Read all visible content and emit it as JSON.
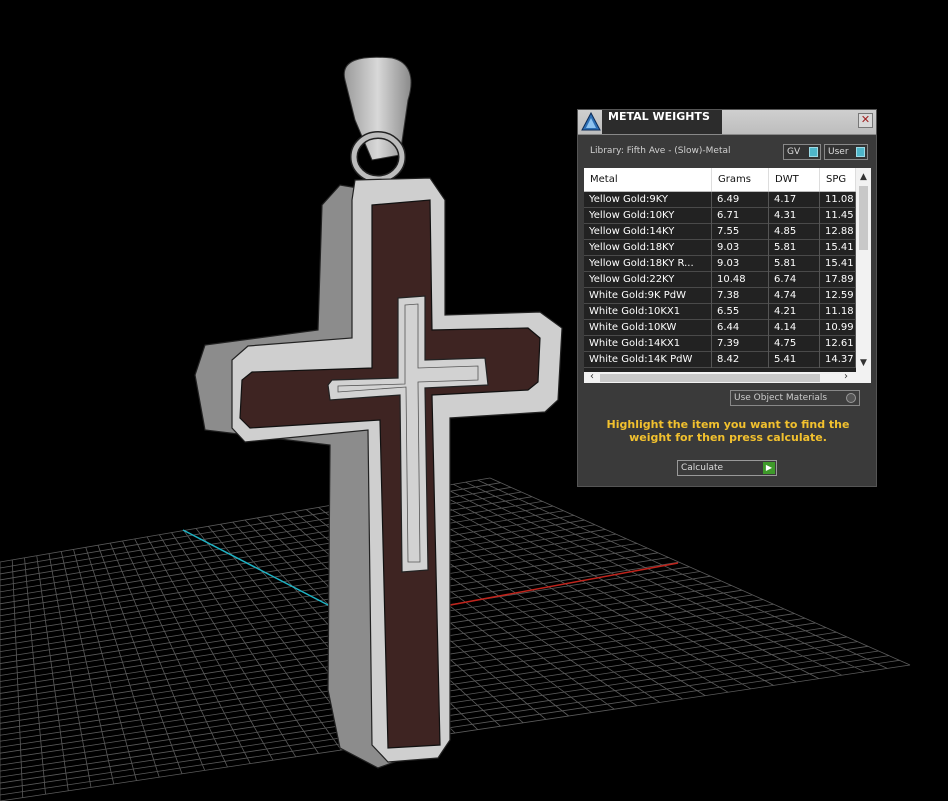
{
  "panel": {
    "title": "METAL WEIGHTS",
    "close_glyph": "✕",
    "library_label": "Library: Fifth Ave - (Slow)-Metal",
    "toggles": [
      {
        "label": "GV"
      },
      {
        "label": "User"
      }
    ],
    "columns": [
      "Metal",
      "Grams",
      "DWT",
      "SPG"
    ],
    "rows": [
      [
        "Yellow Gold:9KY",
        "6.49",
        "4.17",
        "11.08"
      ],
      [
        "Yellow Gold:10KY",
        "6.71",
        "4.31",
        "11.45"
      ],
      [
        "Yellow Gold:14KY",
        "7.55",
        "4.85",
        "12.88"
      ],
      [
        "Yellow Gold:18KY",
        "9.03",
        "5.81",
        "15.41"
      ],
      [
        "Yellow Gold:18KY R...",
        "9.03",
        "5.81",
        "15.41"
      ],
      [
        "Yellow Gold:22KY",
        "10.48",
        "6.74",
        "17.89"
      ],
      [
        "White Gold:9K PdW",
        "7.38",
        "4.74",
        "12.59"
      ],
      [
        "White Gold:10KX1",
        "6.55",
        "4.21",
        "11.18"
      ],
      [
        "White Gold:10KW",
        "6.44",
        "4.14",
        "10.99"
      ],
      [
        "White Gold:14KX1",
        "7.39",
        "4.75",
        "12.61"
      ],
      [
        "White Gold:14K PdW",
        "8.42",
        "5.41",
        "14.37"
      ]
    ],
    "use_object_materials": "Use Object Materials",
    "instruction": "Highlight the item you want to find the weight for then press calculate.",
    "calculate_label": "Calculate"
  },
  "colors": {
    "accent_cyan": "#4fb6c9",
    "instruction_text": "#f2c12e",
    "axis_x": "#c0241c",
    "axis_y": "#1fb3c4",
    "inlay_wood": "#3e2422"
  }
}
